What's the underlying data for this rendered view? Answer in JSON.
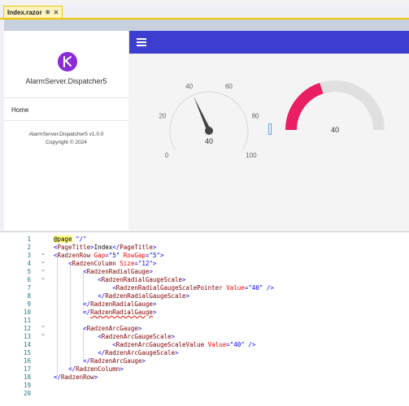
{
  "tab": {
    "title": "Index.razor",
    "pin": "⊕",
    "close": "✕"
  },
  "app": {
    "name": "AlarmServer.Dispatcher5",
    "nav_home": "Home",
    "version": "AlarmServer.Dispatcher5 v1.0.0",
    "copyright": "Copyright © 2024"
  },
  "radial_gauge": {
    "min": 0,
    "max": 100,
    "value": 40,
    "ticks": [
      "0",
      "20",
      "40",
      "60",
      "80",
      "100"
    ],
    "value_label": "40"
  },
  "arc_gauge": {
    "min": 0,
    "max": 100,
    "value": 40,
    "value_label": "40",
    "color": "#e91e63",
    "track_color": "#e0e0e0"
  },
  "colors": {
    "accent": "#3d3dd0",
    "logo": "#8b2cd8"
  },
  "icons": {
    "menu": "hamburger-icon",
    "logo": "k-logo-icon"
  },
  "code": {
    "line_numbers": [
      "1",
      "2",
      "3",
      "4",
      "5",
      "6",
      "7",
      "8",
      "9",
      "10",
      "11",
      "12",
      "13",
      "14",
      "15",
      "16",
      "17",
      "18",
      "19",
      "20"
    ],
    "l1_dir": "@page",
    "l1_str": " \"/\"",
    "l2_open": "PageTitle",
    "l2_text": "Index",
    "l2_close": "PageTitle",
    "l3_tag": "RadzenRow",
    "l3_a1": "Gap",
    "l3_v1": "\"5\"",
    "l3_a2": "RowGap",
    "l3_v2": "\"5\"",
    "l4_tag": "RadzenColumn",
    "l4_a1": "Size",
    "l4_v1": "\"12\"",
    "l5_tag": "RadzenRadialGauge",
    "l6_tag": "RadzenRadialGaugeScale",
    "l7_tag": "RadzenRadialGaugeScalePointer",
    "l7_a1": "Value",
    "l7_v1": "\"40\"",
    "l8_tag": "RadzenRadialGaugeScale",
    "l9_tag": "RadzenRadialGauge",
    "l10_tag": "RadzenRadialGauge",
    "l12_tag": "RadzenArcGauge",
    "l13_tag": "RadzenArcGaugeScale",
    "l14_tag": "RadzenArcGaugeScaleValue",
    "l14_a1": "Value",
    "l14_v1": "\"40\"",
    "l15_tag": "RadzenArcGaugeScale",
    "l16_tag": "RadzenArcGauge",
    "l17_tag": "RadzenColumn",
    "l18_tag": "RadzenRow"
  }
}
